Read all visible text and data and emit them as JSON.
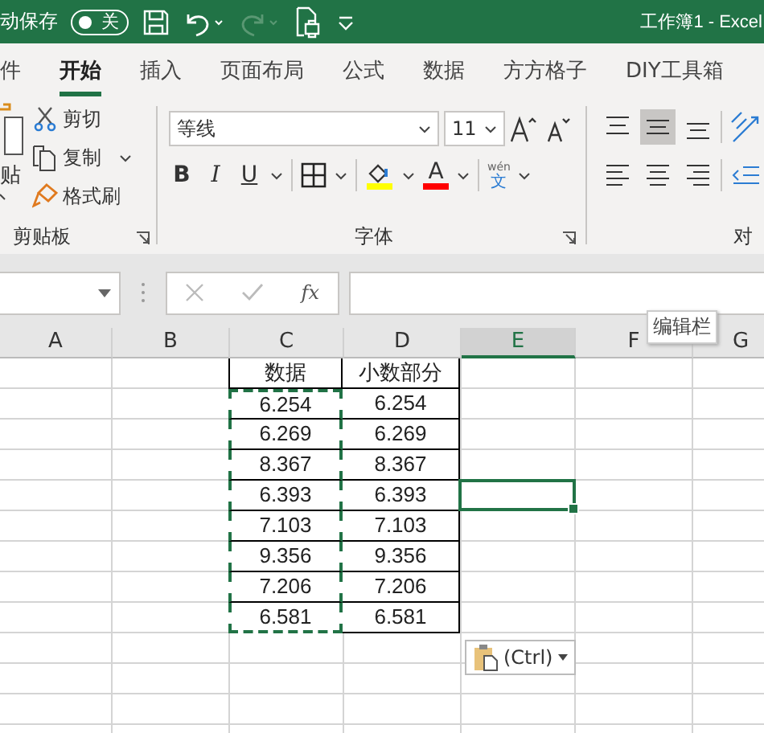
{
  "title_bar": {
    "autosave_label": "动保存",
    "autosave_on": false,
    "autosave_state": "关",
    "title": "工作簿1 - Excel"
  },
  "tabs": [
    {
      "label": "件",
      "selected": false
    },
    {
      "label": "开始",
      "selected": true
    },
    {
      "label": "插入",
      "selected": false
    },
    {
      "label": "页面布局",
      "selected": false
    },
    {
      "label": "公式",
      "selected": false
    },
    {
      "label": "数据",
      "selected": false
    },
    {
      "label": "方方格子",
      "selected": false
    },
    {
      "label": "DIY工具箱",
      "selected": false
    }
  ],
  "clipboard": {
    "paste": "贴",
    "cut": "剪切",
    "copy": "复制",
    "format_painter": "格式刷",
    "label": "剪贴板"
  },
  "font": {
    "name": "等线",
    "size": "11",
    "bold": "B",
    "italic": "I",
    "underline": "U",
    "font_color": "A",
    "phonetic_top": "wén",
    "phonetic_bottom": "文",
    "label": "字体"
  },
  "alignment": {
    "label": "对",
    "middle_selected": true
  },
  "formula_bar": {
    "fx": "fx",
    "tooltip": "编辑栏"
  },
  "columns": [
    {
      "label": "A",
      "selected": false
    },
    {
      "label": "B",
      "selected": false
    },
    {
      "label": "C",
      "selected": false
    },
    {
      "label": "D",
      "selected": false
    },
    {
      "label": "E",
      "selected": true
    },
    {
      "label": "F",
      "selected": false
    },
    {
      "label": "G",
      "selected": false
    }
  ],
  "rows": [
    {
      "cells": [
        "数据",
        "小数部分"
      ],
      "copied": false,
      "e_selected": false
    },
    {
      "cells": [
        "6.254",
        "6.254"
      ],
      "copied": true,
      "e_selected": false
    },
    {
      "cells": [
        "6.269",
        "6.269"
      ],
      "copied": true,
      "e_selected": false
    },
    {
      "cells": [
        "8.367",
        "8.367"
      ],
      "copied": true,
      "e_selected": false
    },
    {
      "cells": [
        "6.393",
        "6.393"
      ],
      "copied": true,
      "e_selected": true
    },
    {
      "cells": [
        "7.103",
        "7.103"
      ],
      "copied": true,
      "e_selected": false
    },
    {
      "cells": [
        "9.356",
        "9.356"
      ],
      "copied": true,
      "e_selected": false
    },
    {
      "cells": [
        "7.206",
        "7.206"
      ],
      "copied": true,
      "e_selected": false
    },
    {
      "cells": [
        "6.581",
        "6.581"
      ],
      "copied": true,
      "e_selected": false
    },
    {
      "copied": false,
      "e_selected": false
    },
    {
      "copied": false,
      "e_selected": false
    },
    {
      "copied": false,
      "e_selected": false
    },
    {
      "copied": false,
      "e_selected": false
    }
  ],
  "paste_options": {
    "label": "(Ctrl)"
  }
}
